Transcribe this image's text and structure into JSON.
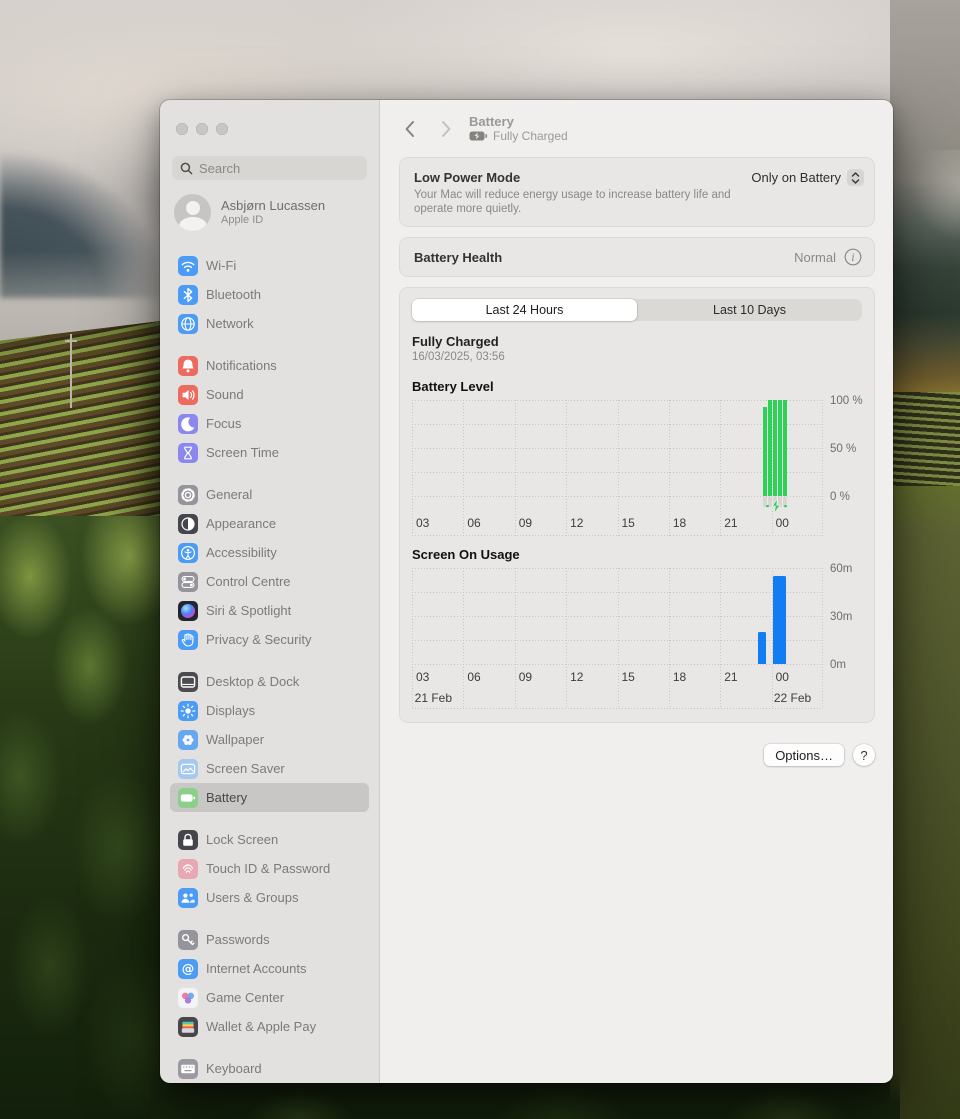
{
  "colors": {
    "accent_green": "#2ed158",
    "accent_blue": "#127df2",
    "card_bg": "#e9e7e5",
    "sidebar_bg": "#e3e1df",
    "content_bg": "#f0efed",
    "selected_row": "#c9c7c5"
  },
  "header": {
    "title": "Battery",
    "status": "Fully Charged"
  },
  "sidebar": {
    "search_placeholder": "Search",
    "profile": {
      "name": "Asbjørn Lucassen",
      "subtitle": "Apple ID"
    },
    "groups": [
      {
        "items": [
          {
            "label": "Wi-Fi",
            "icon": "wifi",
            "color": "#4c9bf5"
          },
          {
            "label": "Bluetooth",
            "icon": "bluetooth",
            "color": "#4c9bf5"
          },
          {
            "label": "Network",
            "icon": "globe",
            "color": "#4c9bf5"
          }
        ]
      },
      {
        "items": [
          {
            "label": "Notifications",
            "icon": "bell",
            "color": "#ec6a5e"
          },
          {
            "label": "Sound",
            "icon": "speaker",
            "color": "#ec6a5e"
          },
          {
            "label": "Focus",
            "icon": "moon",
            "color": "#8a88ef"
          },
          {
            "label": "Screen Time",
            "icon": "hourglass",
            "color": "#8a88ef"
          }
        ]
      },
      {
        "items": [
          {
            "label": "General",
            "icon": "gear",
            "color": "#94949a"
          },
          {
            "label": "Appearance",
            "icon": "appearance",
            "color": "#45454b"
          },
          {
            "label": "Accessibility",
            "icon": "accessibility",
            "color": "#4c9bf5"
          },
          {
            "label": "Control Centre",
            "icon": "toggles",
            "color": "#94949a"
          },
          {
            "label": "Siri & Spotlight",
            "icon": "siri",
            "color": "#23262f"
          },
          {
            "label": "Privacy & Security",
            "icon": "hand",
            "color": "#4c9bf5"
          }
        ]
      },
      {
        "items": [
          {
            "label": "Desktop & Dock",
            "icon": "window",
            "color": "#4b4b50"
          },
          {
            "label": "Displays",
            "icon": "sun",
            "color": "#4c9bf5"
          },
          {
            "label": "Wallpaper",
            "icon": "flower",
            "color": "#66a8f0"
          },
          {
            "label": "Screen Saver",
            "icon": "screensaver",
            "color": "#a3c9ef"
          },
          {
            "label": "Battery",
            "icon": "battery",
            "color": "#8ccf8a",
            "selected": true
          }
        ]
      },
      {
        "items": [
          {
            "label": "Lock Screen",
            "icon": "lock",
            "color": "#45454b"
          },
          {
            "label": "Touch ID & Password",
            "icon": "fingerprint",
            "color": "#e8a7b2"
          },
          {
            "label": "Users & Groups",
            "icon": "users",
            "color": "#4c9bf5"
          }
        ]
      },
      {
        "items": [
          {
            "label": "Passwords",
            "icon": "key",
            "color": "#94949a"
          },
          {
            "label": "Internet Accounts",
            "icon": "at",
            "color": "#4c9bf5"
          },
          {
            "label": "Game Center",
            "icon": "gamecenter",
            "color": "#f4f4f6"
          },
          {
            "label": "Wallet & Apple Pay",
            "icon": "wallet",
            "color": "#47474b"
          }
        ]
      },
      {
        "items": [
          {
            "label": "Keyboard",
            "icon": "keyboard",
            "color": "#9a9aa0"
          }
        ]
      }
    ]
  },
  "low_power": {
    "title": "Low Power Mode",
    "description": "Your Mac will reduce energy usage to increase battery life and operate more quietly.",
    "value": "Only on Battery"
  },
  "battery_health": {
    "label": "Battery Health",
    "value": "Normal"
  },
  "usage": {
    "tabs": [
      "Last 24 Hours",
      "Last 10 Days"
    ],
    "selected_tab": 0,
    "status_title": "Fully Charged",
    "status_time": "16/03/2025, 03:56"
  },
  "chart_data": [
    {
      "type": "bar",
      "title": "Battery Level",
      "ylabel": "charge percent",
      "ylim": [
        0,
        100
      ],
      "grid": true,
      "x_tick_labels": [
        "03",
        "06",
        "09",
        "12",
        "15",
        "18",
        "21",
        "00"
      ],
      "y_tick_labels": [
        "100 %",
        "50 %",
        "0 %"
      ],
      "bar_color": "#2ed158",
      "bars": [
        {
          "x_frac": 0.854,
          "width": 4,
          "value": 93
        },
        {
          "x_frac": 0.8663,
          "width": 4,
          "value": 100
        },
        {
          "x_frac": 0.8785,
          "width": 4,
          "value": 100
        },
        {
          "x_frac": 0.8907,
          "width": 4,
          "value": 100
        },
        {
          "x_frac": 0.9029,
          "width": 4,
          "value": 100
        }
      ],
      "charging_indicator": {
        "x_frac": 0.886,
        "strip_from": 0.854,
        "strip_to": 0.915
      }
    },
    {
      "type": "bar",
      "title": "Screen On Usage",
      "ylabel": "minutes",
      "ylim": [
        0,
        60
      ],
      "grid": true,
      "x_tick_labels": [
        "03",
        "06",
        "09",
        "12",
        "15",
        "18",
        "21",
        "00"
      ],
      "y_tick_labels": [
        "60m",
        "30m",
        "0m"
      ],
      "bar_color": "#127df2",
      "bars": [
        {
          "x_frac": 0.842,
          "width": 8,
          "value": 20
        },
        {
          "x_frac": 0.878,
          "width": 13,
          "value": 55
        }
      ],
      "date_labels": [
        {
          "text": "21 Feb",
          "x_frac": 0.004
        },
        {
          "text": "22 Feb",
          "x_frac": 0.878
        }
      ]
    }
  ],
  "footer": {
    "options_label": "Options…",
    "help_label": "?"
  }
}
